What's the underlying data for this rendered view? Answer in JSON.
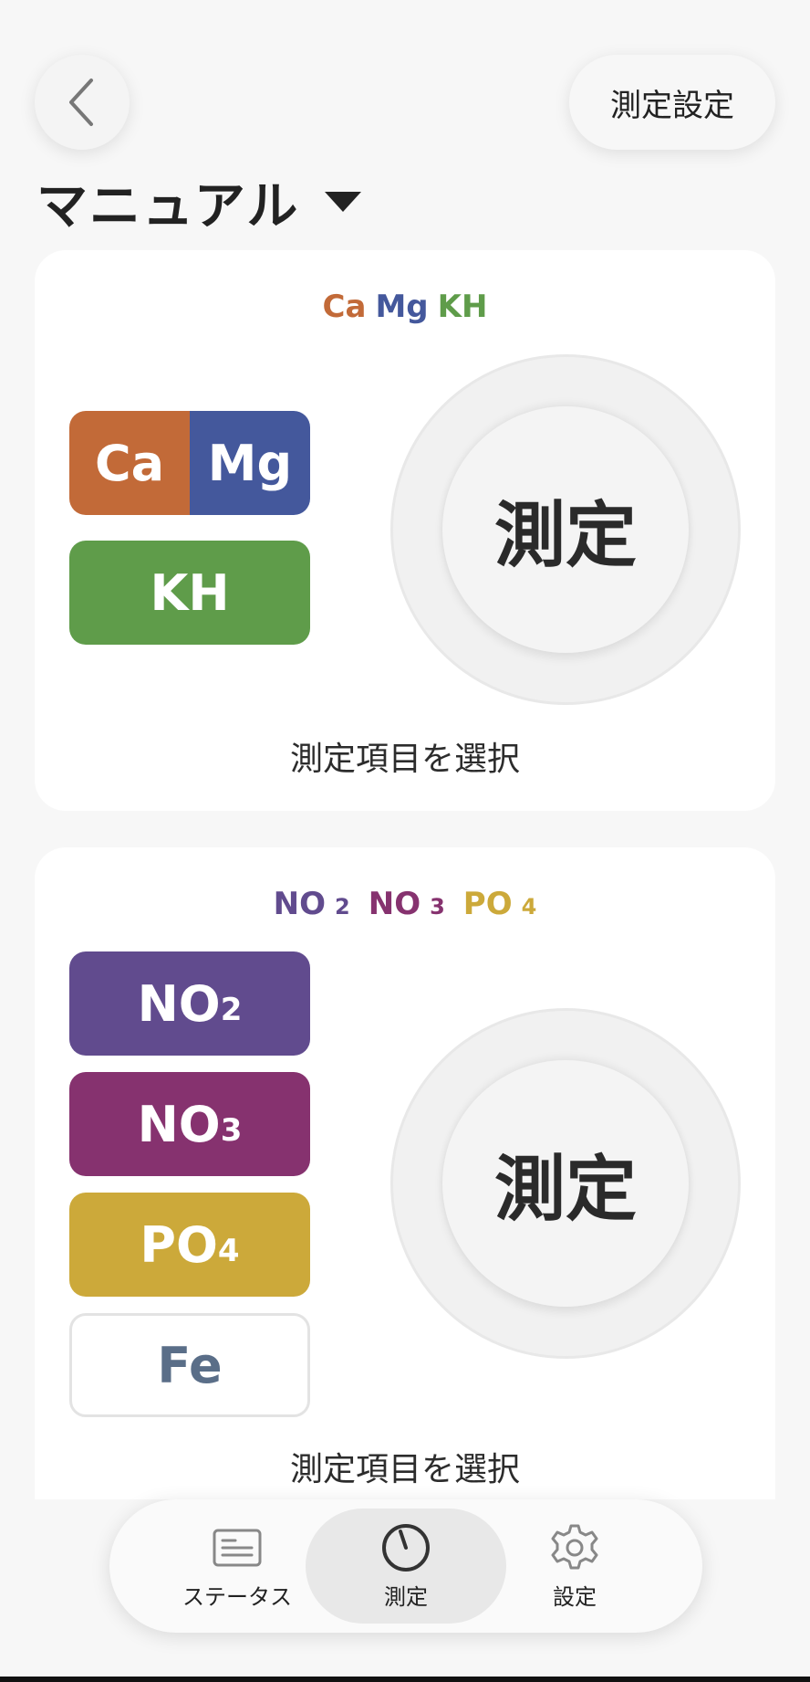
{
  "header": {
    "back_icon": "chevron-left-icon",
    "settings_label": "測定設定"
  },
  "mode": {
    "title": "マニュアル",
    "caret_icon": "caret-down-icon"
  },
  "card1": {
    "header": [
      {
        "text": "Ca",
        "color": "#c26a38"
      },
      {
        "text": "Mg",
        "color": "#44589c"
      },
      {
        "text": "KH",
        "color": "#5f9c4a"
      }
    ],
    "tiles": [
      {
        "left": "Ca",
        "left_color": "#c26a38",
        "right": "Mg",
        "right_color": "#44589c"
      },
      {
        "label": "KH",
        "color": "#5f9c4a"
      }
    ],
    "measure_label": "測定",
    "select_label": "測定項目を選択"
  },
  "card2": {
    "header": [
      {
        "base": "NO",
        "sub": "2",
        "color": "#614b8e"
      },
      {
        "base": "NO",
        "sub": "3",
        "color": "#86326f"
      },
      {
        "base": "PO",
        "sub": "4",
        "color": "#cca93a"
      }
    ],
    "tiles": [
      {
        "base": "NO",
        "sub": "2",
        "color": "#614b8e"
      },
      {
        "base": "NO",
        "sub": "3",
        "color": "#86326f"
      },
      {
        "base": "PO",
        "sub": "4",
        "color": "#cca93a"
      },
      {
        "base": "Fe",
        "sub": "",
        "color": "#5a6e88",
        "outlined": true
      }
    ],
    "measure_label": "測定",
    "select_label": "測定項目を選択"
  },
  "nav": {
    "items": [
      {
        "label": "ステータス",
        "icon": "status-card-icon",
        "active": false
      },
      {
        "label": "測定",
        "icon": "gauge-icon",
        "active": true
      },
      {
        "label": "設定",
        "icon": "gear-icon",
        "active": false
      }
    ]
  }
}
